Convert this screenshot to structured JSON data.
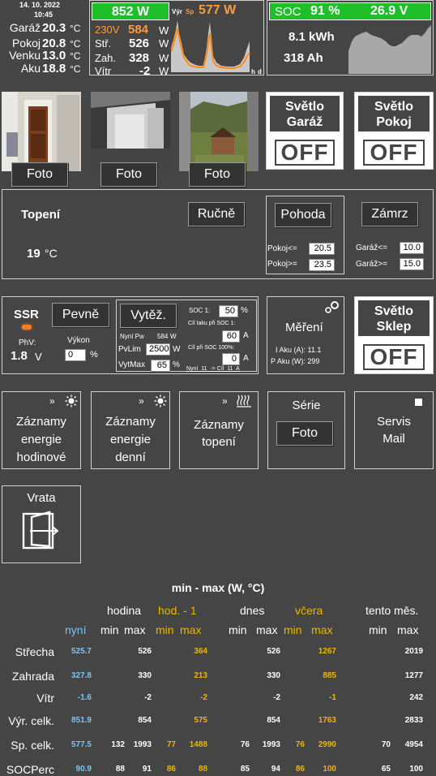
{
  "header": {
    "date": "14. 10. 2022",
    "time": "10:45",
    "temps": [
      {
        "label": "Garáž",
        "value": "20.3",
        "unit": "°C"
      },
      {
        "label": "Pokoj",
        "value": "20.8",
        "unit": "°C"
      },
      {
        "label": "Venku",
        "value": "13.0",
        "unit": "°C"
      },
      {
        "label": "Aku",
        "value": "18.8",
        "unit": "°C"
      }
    ]
  },
  "power": {
    "total": "852 W",
    "vyr_label": "Výr",
    "sp_label": "Sp",
    "sp_value": "577 W",
    "grid_label": "230V",
    "grid_value": "584",
    "unit": "W",
    "rows": [
      {
        "label": "Stř.",
        "value": "526",
        "unit": "W"
      },
      {
        "label": "Zah.",
        "value": "328",
        "unit": "W"
      },
      {
        "label": "Vítr",
        "value": "-2",
        "unit": "W"
      }
    ],
    "axis_h": "h",
    "axis_d": "d"
  },
  "battery": {
    "soc_label": "SOC",
    "soc_value": "91 %",
    "voltage": "26.9 V",
    "kwh": "8.1 kWh",
    "ah": "318 Ah"
  },
  "cameras": [
    {
      "button": "Foto"
    },
    {
      "button": "Foto"
    },
    {
      "button": "Foto"
    }
  ],
  "lights_top": [
    {
      "name": "Světlo\nGaráž",
      "state": "OFF"
    },
    {
      "name": "Světlo\nPokoj",
      "state": "OFF"
    }
  ],
  "heating": {
    "title": "Topení",
    "temp": "19",
    "unit": "°C",
    "btn_manual": "Ručně",
    "btn_comfort": "Pohoda",
    "btn_freeze": "Zámrz",
    "pokoj_le_label": "Pokoj<=",
    "pokoj_le_value": "20.5",
    "pokoj_ge_label": "Pokoj>=",
    "pokoj_ge_value": "23.5",
    "garaz_le_label": "Garáž<=",
    "garaz_le_value": "10.0",
    "garaz_ge_label": "Garáž>=",
    "garaz_ge_value": "15.0"
  },
  "ssr": {
    "title": "SSR",
    "btn_fixed": "Pevně",
    "btn_heat": "Vytěž.",
    "phv_label": "PhV:",
    "phv_value": "1.8",
    "phv_unit": "V",
    "vykon_label": "Výkon",
    "vykon_value": "0",
    "vykon_unit": "%",
    "nyni_pw_label": "Nyní Pw",
    "nyni_pw_value": "584",
    "nyni_pw_unit": "W",
    "pvlim_label": "PvLim",
    "pvlim_value": "2500",
    "pvlim_unit": "W",
    "vytmax_label": "VytMax",
    "vytmax_value": "65",
    "vytmax_unit": "%",
    "soc1_label": "SOC 1:",
    "soc1_value": "50",
    "soc1_unit": "%",
    "cil_soc1_label": "Cíl Iaku při SOC 1:",
    "cil_soc1_value": "60",
    "cil_soc1_unit": "A",
    "cil_soc100_label": "Cíl při SOC 100%:",
    "cil_soc100_value": "0",
    "cil_soc100_unit": "A",
    "nyni_cil": "Nyní  11  -> Cíl  11  A"
  },
  "measure": {
    "title": "Měření",
    "iaku": "I Aku (A): 11.1",
    "paku": "P Aku (W): 299"
  },
  "light_cellar": {
    "name": "Světlo\nSklep",
    "state": "OFF"
  },
  "tiles": [
    {
      "label": "Záznamy\nenergie\nhodinové"
    },
    {
      "label": "Záznamy\nenergie\ndenní"
    },
    {
      "label": "Záznamy\ntopení"
    },
    {
      "label": "Série",
      "button": "Foto"
    },
    {
      "label": "Servis\nMail"
    }
  ],
  "gate": {
    "label": "Vrata"
  },
  "stats": {
    "title": "min - max (W, °C)",
    "groups": [
      "hodina",
      "hod. - 1",
      "dnes",
      "včera",
      "tento měs."
    ],
    "now_label": "nyní",
    "min": "min",
    "max": "max",
    "rows": [
      {
        "label": "Střecha",
        "now": "525.7",
        "h_min": "",
        "h_max": "526",
        "h1_min": "",
        "h1_max": "364",
        "d_min": "",
        "d_max": "526",
        "y_min": "",
        "y_max": "1267",
        "m_min": "",
        "m_max": "2019"
      },
      {
        "label": "Zahrada",
        "now": "327.8",
        "h_min": "",
        "h_max": "330",
        "h1_min": "",
        "h1_max": "213",
        "d_min": "",
        "d_max": "330",
        "y_min": "",
        "y_max": "885",
        "m_min": "",
        "m_max": "1277"
      },
      {
        "label": "Vítr",
        "now": "-1.6",
        "h_min": "",
        "h_max": "-2",
        "h1_min": "",
        "h1_max": "-2",
        "d_min": "",
        "d_max": "-2",
        "y_min": "",
        "y_max": "-1",
        "m_min": "",
        "m_max": "242"
      },
      {
        "label": "Výr. celk.",
        "now": "851.9",
        "h_min": "",
        "h_max": "854",
        "h1_min": "",
        "h1_max": "575",
        "d_min": "",
        "d_max": "854",
        "y_min": "",
        "y_max": "1763",
        "m_min": "",
        "m_max": "2833"
      },
      {
        "label": "Sp. celk.",
        "now": "577.5",
        "h_min": "132",
        "h_max": "1993",
        "h1_min": "77",
        "h1_max": "1488",
        "d_min": "76",
        "d_max": "1993",
        "y_min": "76",
        "y_max": "2990",
        "m_min": "70",
        "m_max": "4954"
      },
      {
        "label": "SOCPerc",
        "now": "90.9",
        "h_min": "88",
        "h_max": "91",
        "h1_min": "86",
        "h1_max": "88",
        "d_min": "85",
        "d_max": "94",
        "y_min": "86",
        "y_max": "100",
        "m_min": "65",
        "m_max": "100"
      }
    ]
  },
  "colors": {
    "background": "#454545",
    "green": "#1fbf2a",
    "orange": "#ff9a3a",
    "yellow": "#f0b400",
    "blue": "#7fc4f0"
  }
}
